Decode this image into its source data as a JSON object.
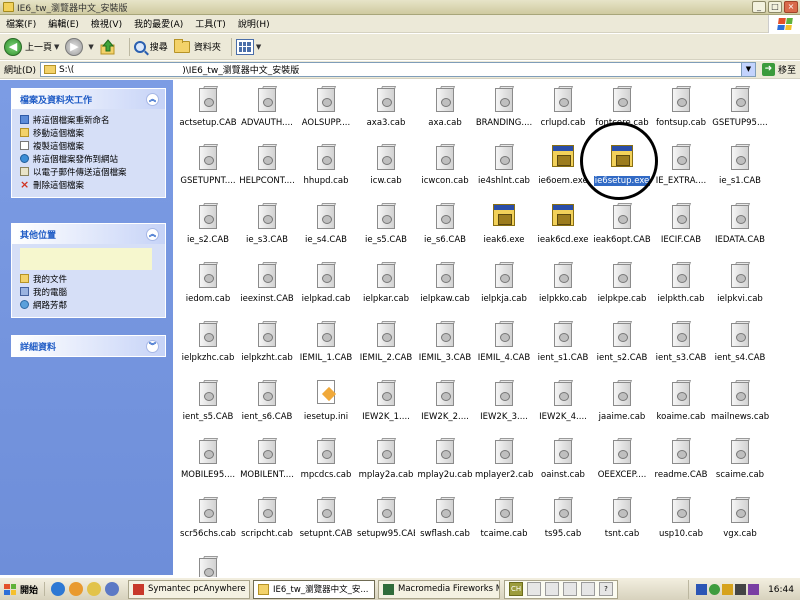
{
  "window": {
    "title": "IE6_tw_瀏覽器中文_安裝版",
    "buttons": {
      "minimize": "_",
      "maximize": "□",
      "close": "×"
    }
  },
  "menu": [
    "檔案(F)",
    "編輯(E)",
    "檢視(V)",
    "我的最愛(A)",
    "工具(T)",
    "說明(H)"
  ],
  "toolbar": {
    "back_label": "上一頁",
    "search_label": "搜尋",
    "folders_label": "資料夾"
  },
  "address": {
    "label": "網址(D)",
    "prefix": "S:\\(",
    "path_suffix": ")\\IE6_tw_瀏覽器中文_安裝版",
    "go_label": "移至"
  },
  "left_panel": {
    "file_tasks": {
      "title": "檔案及資料夾工作",
      "items": [
        {
          "label": "將這個檔案重新命名",
          "icon": "rename-icon"
        },
        {
          "label": "移動這個檔案",
          "icon": "move-icon"
        },
        {
          "label": "複製這個檔案",
          "icon": "copy-icon"
        },
        {
          "label": "將這個檔案發佈到網站",
          "icon": "publish-web-icon"
        },
        {
          "label": "以電子郵件傳送這個檔案",
          "icon": "email-icon"
        },
        {
          "label": "刪除這個檔案",
          "icon": "delete-icon"
        }
      ]
    },
    "other_places": {
      "title": "其他位置",
      "items": [
        {
          "label": "我的文件",
          "icon": "my-documents-icon"
        },
        {
          "label": "我的電腦",
          "icon": "my-computer-icon"
        },
        {
          "label": "網路芳鄰",
          "icon": "network-places-icon"
        }
      ]
    },
    "details": {
      "title": "詳細資料"
    }
  },
  "files": [
    {
      "name": "actsetup.CAB",
      "type": "cab"
    },
    {
      "name": "ADVAUTH....",
      "type": "cab"
    },
    {
      "name": "AOLSUPP....",
      "type": "cab"
    },
    {
      "name": "axa3.cab",
      "type": "cab"
    },
    {
      "name": "axa.cab",
      "type": "cab"
    },
    {
      "name": "BRANDING....",
      "type": "cab"
    },
    {
      "name": "crlupd.cab",
      "type": "cab"
    },
    {
      "name": "fontcore.cab",
      "type": "cab"
    },
    {
      "name": "fontsup.cab",
      "type": "cab"
    },
    {
      "name": "GSETUP95....",
      "type": "cab"
    },
    {
      "name": "GSETUPNT....",
      "type": "cab"
    },
    {
      "name": "HELPCONT....",
      "type": "cab"
    },
    {
      "name": "hhupd.cab",
      "type": "cab"
    },
    {
      "name": "icw.cab",
      "type": "cab"
    },
    {
      "name": "icwcon.cab",
      "type": "cab"
    },
    {
      "name": "ie4shlnt.cab",
      "type": "cab"
    },
    {
      "name": "ie6oem.exe",
      "type": "exe"
    },
    {
      "name": "ie6setup.exe",
      "type": "exe",
      "selected": true
    },
    {
      "name": "IE_EXTRA....",
      "type": "cab"
    },
    {
      "name": "ie_s1.CAB",
      "type": "cab"
    },
    {
      "name": "ie_s2.CAB",
      "type": "cab"
    },
    {
      "name": "ie_s3.CAB",
      "type": "cab"
    },
    {
      "name": "ie_s4.CAB",
      "type": "cab"
    },
    {
      "name": "ie_s5.CAB",
      "type": "cab"
    },
    {
      "name": "ie_s6.CAB",
      "type": "cab"
    },
    {
      "name": "ieak6.exe",
      "type": "exe"
    },
    {
      "name": "ieak6cd.exe",
      "type": "exe"
    },
    {
      "name": "ieak6opt.CAB",
      "type": "cab"
    },
    {
      "name": "IECIF.CAB",
      "type": "cab"
    },
    {
      "name": "IEDATA.CAB",
      "type": "cab"
    },
    {
      "name": "iedom.cab",
      "type": "cab"
    },
    {
      "name": "ieexinst.CAB",
      "type": "cab"
    },
    {
      "name": "ielpkad.cab",
      "type": "cab"
    },
    {
      "name": "ielpkar.cab",
      "type": "cab"
    },
    {
      "name": "ielpkaw.cab",
      "type": "cab"
    },
    {
      "name": "ielpkja.cab",
      "type": "cab"
    },
    {
      "name": "ielpkko.cab",
      "type": "cab"
    },
    {
      "name": "ielpkpe.cab",
      "type": "cab"
    },
    {
      "name": "ielpkth.cab",
      "type": "cab"
    },
    {
      "name": "ielpkvi.cab",
      "type": "cab"
    },
    {
      "name": "ielpkzhc.cab",
      "type": "cab"
    },
    {
      "name": "ielpkzht.cab",
      "type": "cab"
    },
    {
      "name": "IEMIL_1.CAB",
      "type": "cab"
    },
    {
      "name": "IEMIL_2.CAB",
      "type": "cab"
    },
    {
      "name": "IEMIL_3.CAB",
      "type": "cab"
    },
    {
      "name": "IEMIL_4.CAB",
      "type": "cab"
    },
    {
      "name": "ient_s1.CAB",
      "type": "cab"
    },
    {
      "name": "ient_s2.CAB",
      "type": "cab"
    },
    {
      "name": "ient_s3.CAB",
      "type": "cab"
    },
    {
      "name": "ient_s4.CAB",
      "type": "cab"
    },
    {
      "name": "ient_s5.CAB",
      "type": "cab"
    },
    {
      "name": "ient_s6.CAB",
      "type": "cab"
    },
    {
      "name": "iesetup.ini",
      "type": "ini"
    },
    {
      "name": "IEW2K_1....",
      "type": "cab"
    },
    {
      "name": "IEW2K_2....",
      "type": "cab"
    },
    {
      "name": "IEW2K_3....",
      "type": "cab"
    },
    {
      "name": "IEW2K_4....",
      "type": "cab"
    },
    {
      "name": "jaaime.cab",
      "type": "cab"
    },
    {
      "name": "koaime.cab",
      "type": "cab"
    },
    {
      "name": "mailnews.cab",
      "type": "cab"
    },
    {
      "name": "MOBILE95....",
      "type": "cab"
    },
    {
      "name": "MOBILENT....",
      "type": "cab"
    },
    {
      "name": "mpcdcs.cab",
      "type": "cab"
    },
    {
      "name": "mplay2a.cab",
      "type": "cab"
    },
    {
      "name": "mplay2u.cab",
      "type": "cab"
    },
    {
      "name": "mplayer2.cab",
      "type": "cab"
    },
    {
      "name": "oainst.cab",
      "type": "cab"
    },
    {
      "name": "OEEXCEP....",
      "type": "cab"
    },
    {
      "name": "readme.CAB",
      "type": "cab"
    },
    {
      "name": "scaime.cab",
      "type": "cab"
    },
    {
      "name": "scr56chs.cab",
      "type": "cab"
    },
    {
      "name": "scripcht.cab",
      "type": "cab"
    },
    {
      "name": "setupnt.CAB",
      "type": "cab"
    },
    {
      "name": "setupw95.CAB",
      "type": "cab"
    },
    {
      "name": "swflash.cab",
      "type": "cab"
    },
    {
      "name": "tcaime.cab",
      "type": "cab"
    },
    {
      "name": "ts95.cab",
      "type": "cab"
    },
    {
      "name": "tsnt.cab",
      "type": "cab"
    },
    {
      "name": "usp10.cab",
      "type": "cab"
    },
    {
      "name": "vgx.cab",
      "type": "cab"
    },
    {
      "name": "",
      "type": "cab"
    }
  ],
  "taskbar": {
    "start_label": "開始",
    "tasks": [
      {
        "label": "Symantec pcAnywhere",
        "active": false
      },
      {
        "label": "IE6_tw_瀏覽器中文_安...",
        "active": true
      },
      {
        "label": "Macromedia Fireworks M...",
        "active": false
      }
    ],
    "lang_label": "CH",
    "clock": "16:44"
  }
}
